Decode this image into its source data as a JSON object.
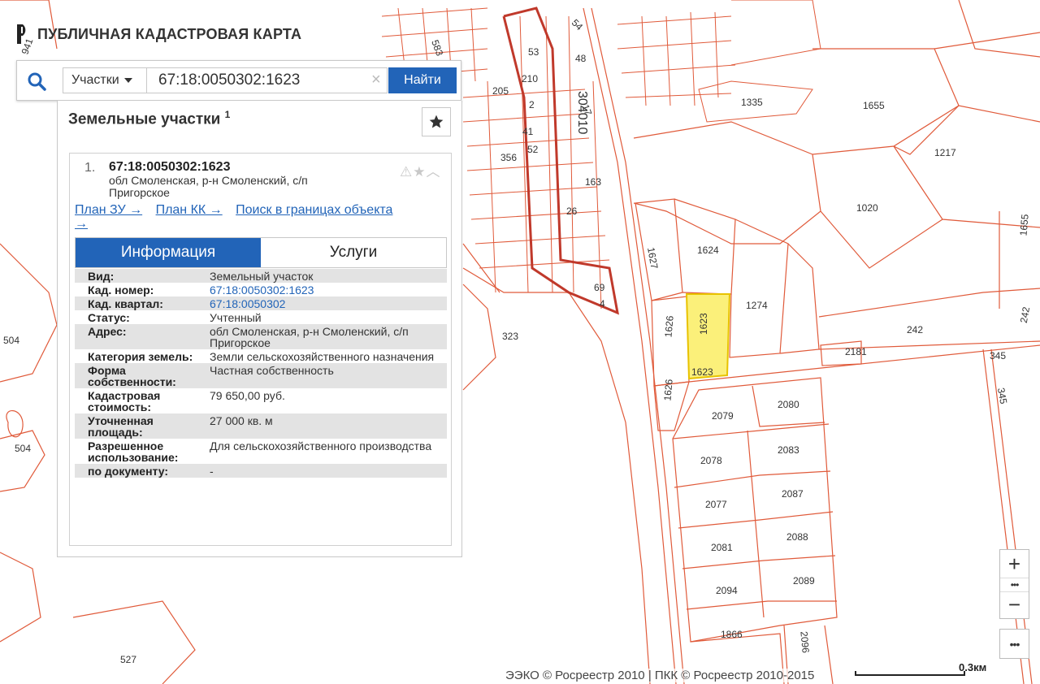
{
  "header": {
    "logo_text": "ПУБЛИЧНАЯ КАДАСТРОВАЯ КАРТА"
  },
  "search": {
    "type_label": "Участки",
    "query": "67:18:0050302:1623",
    "clear_symbol": "×",
    "find_label": "Найти"
  },
  "panel": {
    "title": "Земельные участки",
    "count": "1",
    "card": {
      "index": "1.",
      "cad_number": "67:18:0050302:1623",
      "address": "обл Смоленская, р-н Смоленский, с/п Пригорское",
      "links": [
        "План ЗУ →",
        "План КК →",
        "Поиск в границах объекта →"
      ],
      "tabs": {
        "info": "Информация",
        "services": "Услуги"
      },
      "rows": [
        {
          "key": "Вид:",
          "value": "Земельный участок"
        },
        {
          "key": "Кад. номер:",
          "value": "67:18:0050302:1623"
        },
        {
          "key": "Кад. квартал:",
          "value": "67:18:0050302"
        },
        {
          "key": "Статус:",
          "value": "Учтенный"
        },
        {
          "key": "Адрес:",
          "value": "обл Смоленская, р-н Смоленский, с/п Пригорское"
        },
        {
          "key": "Категория земель:",
          "value": "Земли сельскохозяйственного назначения"
        },
        {
          "key": "Форма собственности:",
          "value": "Частная собственность"
        },
        {
          "key": "Кадастровая стоимость:",
          "value": "79 650,00 руб."
        },
        {
          "key": "Уточненная площадь:",
          "value": "27 000 кв. м"
        },
        {
          "key": "Разрешенное использование:",
          "value": "Для сельскохозяйственного производства"
        },
        {
          "key": "по документу:",
          "value": "-"
        }
      ]
    }
  },
  "map": {
    "parcel_labels": [
      "1623",
      "1623",
      "1624",
      "1627",
      "1626",
      "1626",
      "1274",
      "242",
      "242",
      "345",
      "345",
      "2181",
      "1335",
      "1655",
      "1655",
      "1217",
      "1020",
      "2079",
      "2080",
      "2078",
      "2083",
      "2077",
      "2087",
      "2081",
      "2088",
      "2094",
      "2089",
      "1866",
      "2096",
      "323",
      "504",
      "504",
      "527",
      "53",
      "48",
      "54",
      "210",
      "2",
      "41",
      "52",
      "356",
      "205",
      "583",
      "163",
      "26",
      "69",
      "4",
      "17",
      "941",
      "304010"
    ],
    "colors": {
      "boundary": "#e05a3a",
      "selected_fill": "#fbf07a",
      "selected_stroke": "#e8c200",
      "quarter_boundary": "#c0392b"
    },
    "zoom_in": "+",
    "zoom_out": "−",
    "zoom_dots": "•••",
    "more": "•••",
    "attribution": "ЭЭКО © Росреестр 2010 | ПКК © Росреестр 2010-2015",
    "scale": "0.3км"
  }
}
